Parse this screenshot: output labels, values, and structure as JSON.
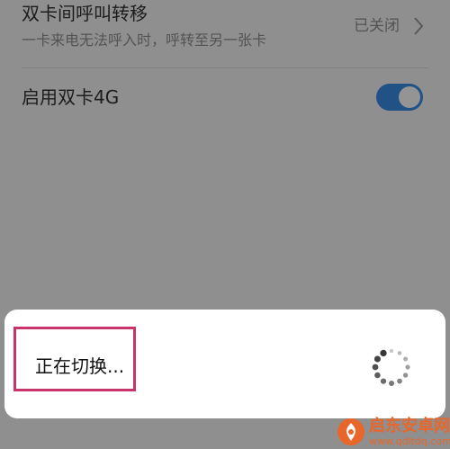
{
  "settings": {
    "call_forwarding": {
      "title": "双卡间呼叫转移",
      "subtitle": "一卡来电无法呼入时，呼转至另一张卡",
      "status": "已关闭"
    },
    "dual_4g": {
      "title": "启用双卡4G",
      "enabled": true
    }
  },
  "dialog": {
    "message": "正在切换..."
  },
  "watermark": {
    "brand": "启东安卓网",
    "url": "www.qdltdq.com"
  },
  "colors": {
    "toggle_on": "#3a8ee6",
    "highlight_border": "#c8336c",
    "watermark": "#e8662a"
  }
}
